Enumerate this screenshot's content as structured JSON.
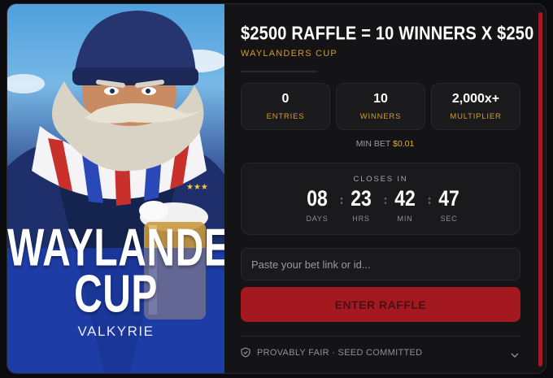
{
  "art": {
    "title_line1": "WAYLANDERS",
    "title_line2": "CUP",
    "subtitle": "VALKYRIE"
  },
  "raffle": {
    "headline": "$2500 RAFFLE = 10 WINNERS X $250",
    "subheadline": "WAYLANDERS CUP",
    "progress": 0
  },
  "stats": [
    {
      "value": "0",
      "label": "ENTRIES"
    },
    {
      "value": "10",
      "label": "WINNERS"
    },
    {
      "value": "2,000x+",
      "label": "MULTIPLIER"
    }
  ],
  "min_bet": {
    "label": "MIN BET",
    "amount": "$0.01"
  },
  "countdown": {
    "label": "CLOSES IN",
    "units": [
      {
        "value": "08",
        "label": "DAYS"
      },
      {
        "value": "23",
        "label": "HRS"
      },
      {
        "value": "42",
        "label": "MIN"
      },
      {
        "value": "47",
        "label": "SEC"
      }
    ]
  },
  "bet_input": {
    "placeholder": "Paste your bet link or id...",
    "value": ""
  },
  "enter_button": {
    "label": "ENTER RAFFLE"
  },
  "fairness": {
    "label": "PROVABLY FAIR · SEED COMMITTED"
  },
  "colors": {
    "accent_gold": "#d19c2c",
    "button_red": "#a3191f",
    "panel_bg": "#141416"
  }
}
